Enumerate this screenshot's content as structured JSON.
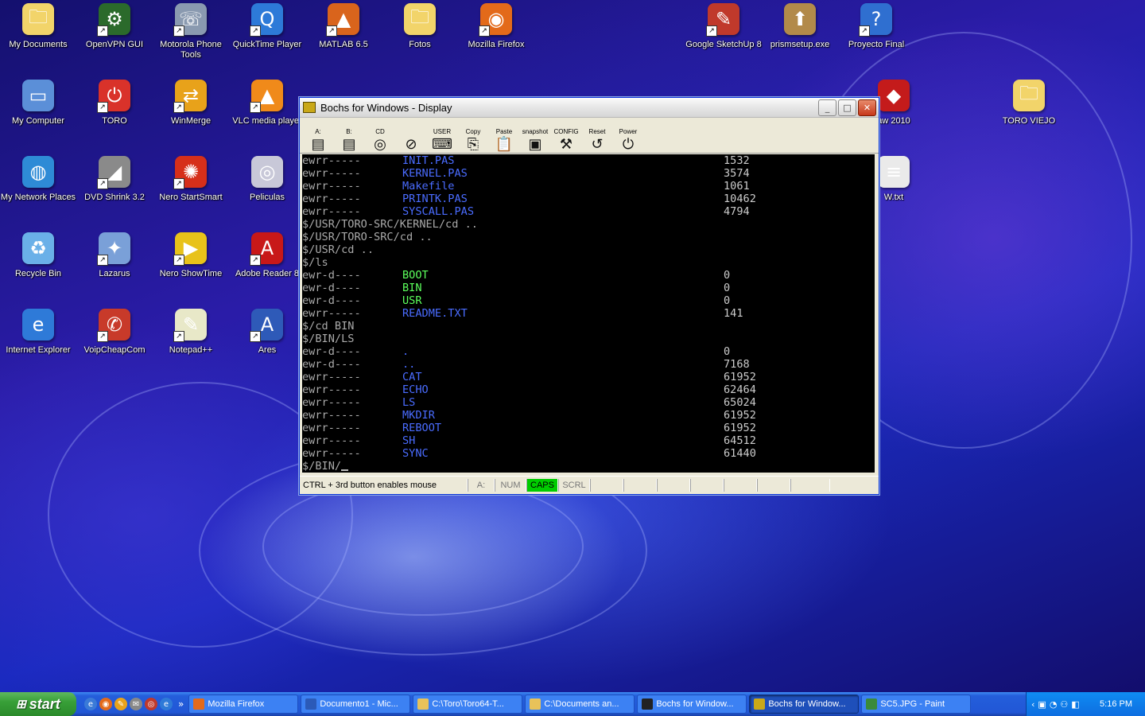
{
  "desktop_icons": [
    {
      "label": "My Documents",
      "icon": "folder-documents-icon",
      "color": "#f2d46a",
      "glyph": "🗀",
      "shortcut": false
    },
    {
      "label": "OpenVPN GUI",
      "icon": "network-icon",
      "color": "#2b6a2b",
      "glyph": "⚙",
      "shortcut": true
    },
    {
      "label": "Motorola Phone Tools",
      "icon": "phone-icon",
      "color": "#8a9ab0",
      "glyph": "☏",
      "shortcut": true
    },
    {
      "label": "QuickTime Player",
      "icon": "quicktime-icon",
      "color": "#2d7ad8",
      "glyph": "Q",
      "shortcut": true
    },
    {
      "label": "MATLAB 6.5",
      "icon": "matlab-icon",
      "color": "#d9641c",
      "glyph": "▲",
      "shortcut": true
    },
    {
      "label": "Fotos",
      "icon": "folder-icon",
      "color": "#f2d46a",
      "glyph": "🗀",
      "shortcut": false
    },
    {
      "label": "Mozilla Firefox",
      "icon": "firefox-icon",
      "color": "#e36a1a",
      "glyph": "◉",
      "shortcut": true
    },
    {
      "label": "Google SketchUp 8",
      "icon": "sketchup-icon",
      "color": "#c0392b",
      "glyph": "✎",
      "shortcut": true
    },
    {
      "label": "prismsetup.exe",
      "icon": "installer-icon",
      "color": "#b28a4a",
      "glyph": "⬆",
      "shortcut": false
    },
    {
      "label": "Proyecto Final",
      "icon": "help-icon",
      "color": "#2f6fd0",
      "glyph": "?",
      "shortcut": true
    },
    {
      "label": "My Computer",
      "icon": "computer-icon",
      "color": "#5b8fd8",
      "glyph": "▭",
      "shortcut": false
    },
    {
      "label": "TORO",
      "icon": "power-icon",
      "color": "#d9322a",
      "glyph": "⏻",
      "shortcut": true
    },
    {
      "label": "WinMerge",
      "icon": "winmerge-icon",
      "color": "#e8a21a",
      "glyph": "⇄",
      "shortcut": true
    },
    {
      "label": "VLC media player",
      "icon": "vlc-icon",
      "color": "#f08a1a",
      "glyph": "▲",
      "shortcut": true
    },
    {
      "label": "aw 2010",
      "icon": "app-icon",
      "color": "#c41b1b",
      "glyph": "◆",
      "shortcut": false
    },
    {
      "label": "TORO VIEJO",
      "icon": "folder-icon",
      "color": "#f2d46a",
      "glyph": "🗀",
      "shortcut": false
    },
    {
      "label": "My Network Places",
      "icon": "network-places-icon",
      "color": "#2e8bd6",
      "glyph": "◍",
      "shortcut": false
    },
    {
      "label": "DVD Shrink 3.2",
      "icon": "dvd-icon",
      "color": "#8a8a8a",
      "glyph": "◢",
      "shortcut": true
    },
    {
      "label": "Nero StartSmart",
      "icon": "nero-icon",
      "color": "#d62f1a",
      "glyph": "✺",
      "shortcut": true
    },
    {
      "label": "Peliculas",
      "icon": "cd-icon",
      "color": "#c8c8d8",
      "glyph": "◎",
      "shortcut": false
    },
    {
      "label": "W.txt",
      "icon": "text-file-icon",
      "color": "#eaeaea",
      "glyph": "≡",
      "shortcut": false
    },
    {
      "label": "Recycle Bin",
      "icon": "recycle-bin-icon",
      "color": "#6ab0e8",
      "glyph": "♻",
      "shortcut": false
    },
    {
      "label": "Lazarus",
      "icon": "lazarus-icon",
      "color": "#7aa0d8",
      "glyph": "✦",
      "shortcut": true
    },
    {
      "label": "Nero ShowTime",
      "icon": "play-icon",
      "color": "#e8c21a",
      "glyph": "▶",
      "shortcut": true
    },
    {
      "label": "Adobe Reader 8",
      "icon": "pdf-icon",
      "color": "#c81818",
      "glyph": "A",
      "shortcut": true
    },
    {
      "label": "Internet Explorer",
      "icon": "ie-icon",
      "color": "#2e7ad8",
      "glyph": "e",
      "shortcut": false
    },
    {
      "label": "VoipCheapCom",
      "icon": "phone-handset-icon",
      "color": "#c83a2a",
      "glyph": "✆",
      "shortcut": true
    },
    {
      "label": "Notepad++",
      "icon": "notepad-icon",
      "color": "#e8e8c8",
      "glyph": "✎",
      "shortcut": true
    },
    {
      "label": "Ares",
      "icon": "ares-icon",
      "color": "#2e5ab8",
      "glyph": "A",
      "shortcut": true
    }
  ],
  "window": {
    "title": "Bochs for Windows - Display",
    "toolbar": [
      {
        "label": "A:",
        "icon": "floppy-a-icon",
        "glyph": "▤"
      },
      {
        "label": "B:",
        "icon": "floppy-b-icon",
        "glyph": "▤"
      },
      {
        "label": "CD",
        "icon": "cdrom-icon",
        "glyph": "◎"
      },
      {
        "label": "",
        "icon": "cdrom-disabled-icon",
        "glyph": "⊘"
      },
      {
        "label": "USER",
        "icon": "keyboard-icon",
        "glyph": "⌨"
      },
      {
        "label": "Copy",
        "icon": "copy-icon",
        "glyph": "⎘"
      },
      {
        "label": "Paste",
        "icon": "paste-icon",
        "glyph": "📋"
      },
      {
        "label": "snapshot",
        "icon": "camera-icon",
        "glyph": "▣"
      },
      {
        "label": "CONFIG",
        "icon": "config-tools-icon",
        "glyph": "⚒"
      },
      {
        "label": "Reset",
        "icon": "reset-icon",
        "glyph": "↺"
      },
      {
        "label": "Power",
        "icon": "power-icon",
        "glyph": "⏻"
      }
    ],
    "terminal": [
      {
        "perm": "ewrr-----",
        "name": "INIT.PAS",
        "size": "1532",
        "kind": "file"
      },
      {
        "perm": "ewrr-----",
        "name": "KERNEL.PAS",
        "size": "3574",
        "kind": "file"
      },
      {
        "perm": "ewrr-----",
        "name": "Makefile",
        "size": "1061",
        "kind": "file"
      },
      {
        "perm": "ewrr-----",
        "name": "PRINTK.PAS",
        "size": "10462",
        "kind": "file"
      },
      {
        "perm": "ewrr-----",
        "name": "SYSCALL.PAS",
        "size": "4794",
        "kind": "file"
      },
      {
        "cmd": "$/USR/TORO-SRC/KERNEL/cd .."
      },
      {
        "cmd": "$/USR/TORO-SRC/cd .."
      },
      {
        "cmd": "$/USR/cd .."
      },
      {
        "cmd": "$/ls"
      },
      {
        "perm": "ewr-d----",
        "name": "BOOT",
        "size": "0",
        "kind": "dir"
      },
      {
        "perm": "ewr-d----",
        "name": "BIN",
        "size": "0",
        "kind": "dir"
      },
      {
        "perm": "ewr-d----",
        "name": "USR",
        "size": "0",
        "kind": "dir"
      },
      {
        "perm": "ewrr-----",
        "name": "README.TXT",
        "size": "141",
        "kind": "file"
      },
      {
        "cmd": "$/cd BIN"
      },
      {
        "cmd": "$/BIN/LS"
      },
      {
        "perm": "ewr-d----",
        "name": ".",
        "size": "0",
        "kind": "file"
      },
      {
        "perm": "ewr-d----",
        "name": "..",
        "size": "7168",
        "kind": "file"
      },
      {
        "perm": "ewrr-----",
        "name": "CAT",
        "size": "61952",
        "kind": "file"
      },
      {
        "perm": "ewrr-----",
        "name": "ECHO",
        "size": "62464",
        "kind": "file"
      },
      {
        "perm": "ewrr-----",
        "name": "LS",
        "size": "65024",
        "kind": "file"
      },
      {
        "perm": "ewrr-----",
        "name": "MKDIR",
        "size": "61952",
        "kind": "file"
      },
      {
        "perm": "ewrr-----",
        "name": "REBOOT",
        "size": "61952",
        "kind": "file"
      },
      {
        "perm": "ewrr-----",
        "name": "SH",
        "size": "64512",
        "kind": "file"
      },
      {
        "perm": "ewrr-----",
        "name": "SYNC",
        "size": "61440",
        "kind": "file"
      }
    ],
    "prompt": "$/BIN/",
    "status": {
      "hint": "CTRL + 3rd button enables mouse",
      "drive": "A:",
      "num": "NUM",
      "caps": "CAPS",
      "scrl": "SCRL"
    }
  },
  "taskbar": {
    "start_label": "start",
    "tasks": [
      {
        "label": "Mozilla Firefox",
        "icon": "firefox-icon",
        "color": "#e36a1a",
        "active": false
      },
      {
        "label": "Documento1 - Mic...",
        "icon": "word-icon",
        "color": "#2b5ab8",
        "active": false
      },
      {
        "label": "C:\\Toro\\Toro64-T...",
        "icon": "folder-icon",
        "color": "#e8c25a",
        "active": false
      },
      {
        "label": "C:\\Documents an...",
        "icon": "folder-icon",
        "color": "#e8c25a",
        "active": false
      },
      {
        "label": "Bochs for Window...",
        "icon": "console-icon",
        "color": "#222222",
        "active": false
      },
      {
        "label": "Bochs for Window...",
        "icon": "bochs-icon",
        "color": "#c9a818",
        "active": true
      },
      {
        "label": "SC5.JPG - Paint",
        "icon": "paint-icon",
        "color": "#3a8a3a",
        "active": false
      }
    ],
    "clock": "5:16 PM"
  }
}
